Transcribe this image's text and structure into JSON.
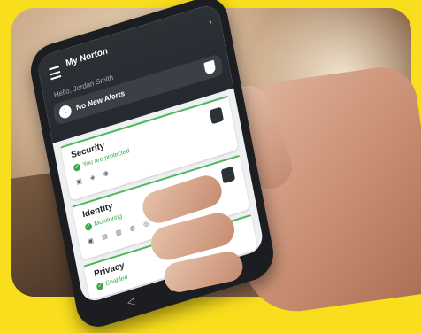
{
  "app": {
    "title": "My Norton",
    "greeting": "Hello, Jordan Smith",
    "alerts_label": "No New Alerts"
  },
  "cards": [
    {
      "title": "Security",
      "status": "You are protected"
    },
    {
      "title": "Identity",
      "status": "Monitoring"
    },
    {
      "title": "Privacy",
      "status": "Enabled"
    }
  ],
  "nav": {
    "back": "◁",
    "home": "○",
    "recent": "□"
  },
  "colors": {
    "frame": "#f9de1d",
    "ok": "#3aa84a",
    "header": "#2c3136"
  }
}
